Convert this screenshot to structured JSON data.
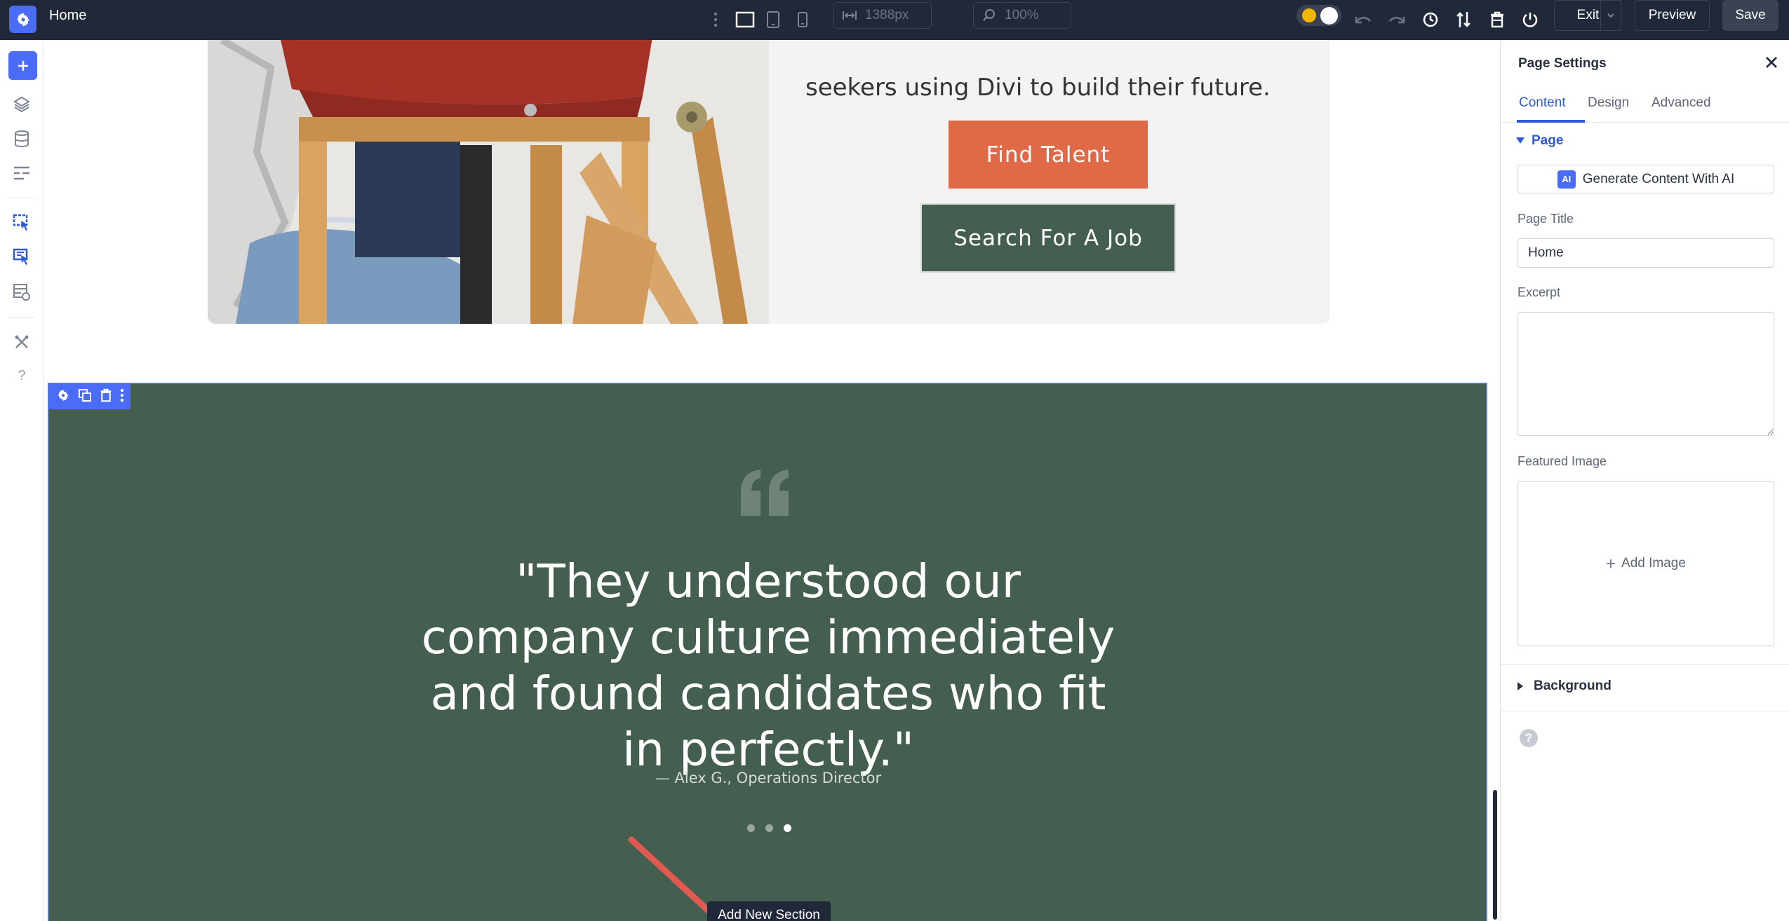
{
  "topbar": {
    "title": "Home",
    "width_value": "1388px",
    "zoom_value": "100%",
    "exit_label": "Exit",
    "preview_label": "Preview",
    "save_label": "Save"
  },
  "canvas": {
    "hero_text": "seekers using Divi to build their future.",
    "find_talent_label": "Find Talent",
    "search_job_label": "Search For A Job",
    "quote_text": "\"They understood our company culture immediately and found candidates who fit in perfectly.\"",
    "quote_author": "— Alex G., Operations Director",
    "slider_active_index": 3,
    "slider_count": 3,
    "tooltip": "Add New Section"
  },
  "panel": {
    "title": "Page Settings",
    "tabs": [
      {
        "label": "Content",
        "active": true
      },
      {
        "label": "Design",
        "active": false
      },
      {
        "label": "Advanced",
        "active": false
      }
    ],
    "group_label": "Page",
    "ai_badge": "AI",
    "ai_button_label": "Generate Content With AI",
    "page_title_label": "Page Title",
    "page_title_value": "Home",
    "excerpt_label": "Excerpt",
    "featured_image_label": "Featured Image",
    "add_image_label": "Add Image",
    "background_label": "Background",
    "help_glyph": "?"
  },
  "colors": {
    "accent": "#4a6cf7",
    "topbar_bg": "#21283a",
    "section_green": "#445e4f",
    "find_talent_orange": "#e06a48"
  }
}
